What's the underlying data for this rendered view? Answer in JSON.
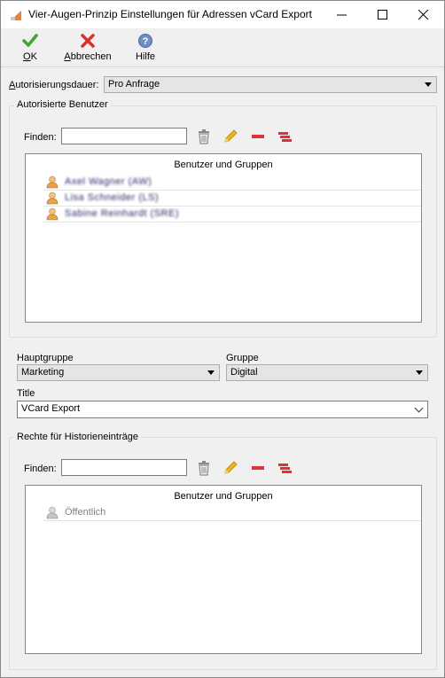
{
  "window": {
    "title": "Vier-Augen-Prinzip Einstellungen für Adressen vCard Export"
  },
  "toolbar": {
    "ok_prefix": "",
    "ok_underlined": "O",
    "ok_rest": "K",
    "cancel_underlined": "A",
    "cancel_rest": "bbrechen",
    "help_label": "Hilfe"
  },
  "authorization": {
    "duration_label_underlined": "A",
    "duration_label_rest": "utorisierungsdauer:",
    "duration_value": "Pro Anfrage"
  },
  "authorized_users": {
    "group_title": "Autorisierte Benutzer",
    "find_label": "Finden:",
    "find_value": "",
    "list_header": "Benutzer und Gruppen",
    "rows": [
      {
        "text": "Axel Wagner (AW)"
      },
      {
        "text": "Lisa Schneider (LS)"
      },
      {
        "text": "Sabine Reinhardt (SRE)"
      }
    ]
  },
  "fields": {
    "hauptgruppe_label": "Hauptgruppe",
    "hauptgruppe_value": "Marketing",
    "gruppe_label": "Gruppe",
    "gruppe_value": "Digital",
    "title_label": "Title",
    "title_value": "VCard Export"
  },
  "history_rights": {
    "group_title": "Rechte für Historieneinträge",
    "find_label": "Finden:",
    "find_value": "",
    "list_header": "Benutzer und Gruppen",
    "rows": [
      {
        "text": "Öffentlich"
      }
    ]
  }
}
